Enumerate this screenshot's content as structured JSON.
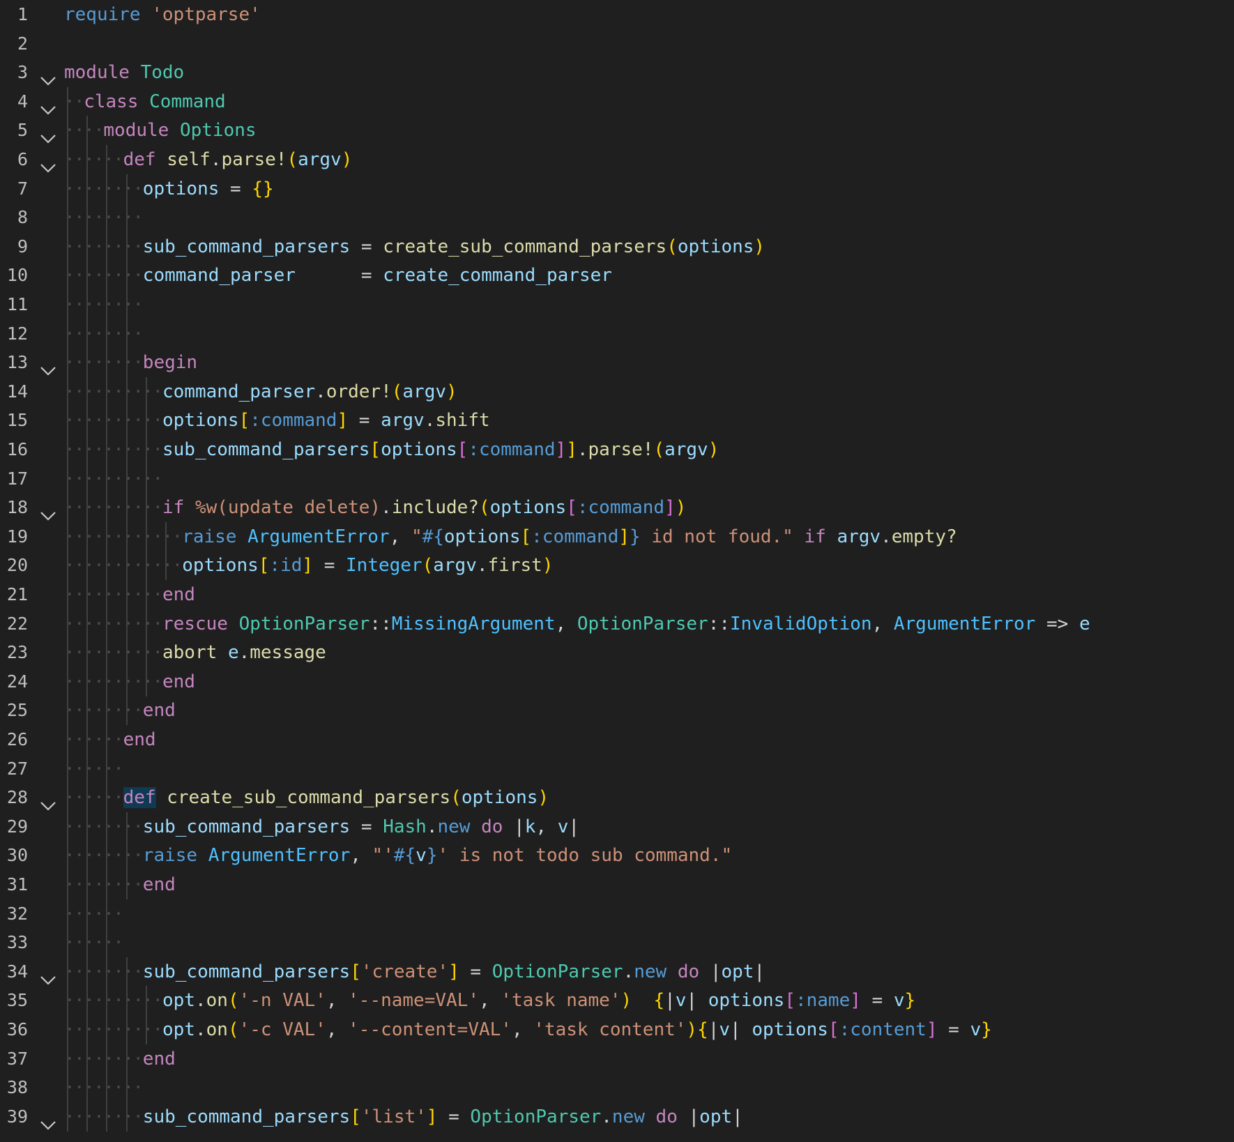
{
  "editor": {
    "language": "ruby",
    "colors": {
      "background": "#1f1f1f",
      "line_number": "#bfbfbf",
      "keyword": "#c586c0",
      "string": "#ce9178",
      "class": "#4ec9b0",
      "constant": "#4fc1ff",
      "function": "#dcdcaa",
      "variable": "#9cdcfe",
      "bracket_1": "#ffd700",
      "bracket_2": "#da70d6",
      "bracket_3": "#179fff",
      "selection": "#0f3a54"
    },
    "fold_icon": "chevron-down-icon",
    "lines": [
      {
        "n": "1",
        "fold": false,
        "indent": 0,
        "tokens": [
          [
            "t-kw2",
            "require"
          ],
          [
            "t-plain",
            " "
          ],
          [
            "t-str",
            "'optparse'"
          ]
        ]
      },
      {
        "n": "2",
        "fold": false,
        "indent": 0,
        "tokens": []
      },
      {
        "n": "3",
        "fold": true,
        "indent": 0,
        "tokens": [
          [
            "t-kw",
            "module"
          ],
          [
            "t-plain",
            " "
          ],
          [
            "t-cls",
            "Todo"
          ]
        ]
      },
      {
        "n": "4",
        "fold": true,
        "indent": 1,
        "tokens": [
          [
            "t-kw",
            "class"
          ],
          [
            "t-plain",
            " "
          ],
          [
            "t-cls",
            "Command"
          ]
        ]
      },
      {
        "n": "5",
        "fold": true,
        "indent": 2,
        "tokens": [
          [
            "t-kw",
            "module"
          ],
          [
            "t-plain",
            " "
          ],
          [
            "t-cls",
            "Options"
          ]
        ]
      },
      {
        "n": "6",
        "fold": true,
        "indent": 3,
        "tokens": [
          [
            "t-kw",
            "def"
          ],
          [
            "t-plain",
            " "
          ],
          [
            "t-fn",
            "self"
          ],
          [
            "t-plain",
            "."
          ],
          [
            "t-fn",
            "parse!"
          ],
          [
            "t-br1",
            "("
          ],
          [
            "t-var",
            "argv"
          ],
          [
            "t-br1",
            ")"
          ]
        ]
      },
      {
        "n": "7",
        "fold": false,
        "indent": 4,
        "tokens": [
          [
            "t-var",
            "options"
          ],
          [
            "t-plain",
            " = "
          ],
          [
            "t-br1",
            "{}"
          ]
        ]
      },
      {
        "n": "8",
        "fold": false,
        "indent": 4,
        "tokens": []
      },
      {
        "n": "9",
        "fold": false,
        "indent": 4,
        "tokens": [
          [
            "t-var",
            "sub_command_parsers"
          ],
          [
            "t-plain",
            " = "
          ],
          [
            "t-fn",
            "create_sub_command_parsers"
          ],
          [
            "t-br1",
            "("
          ],
          [
            "t-var",
            "options"
          ],
          [
            "t-br1",
            ")"
          ]
        ]
      },
      {
        "n": "10",
        "fold": false,
        "indent": 4,
        "tokens": [
          [
            "t-var",
            "command_parser"
          ],
          [
            "t-plain",
            "      = "
          ],
          [
            "t-var",
            "create_command_parser"
          ]
        ]
      },
      {
        "n": "11",
        "fold": false,
        "indent": 4,
        "tokens": []
      },
      {
        "n": "12",
        "fold": false,
        "indent": 4,
        "tokens": []
      },
      {
        "n": "13",
        "fold": true,
        "indent": 4,
        "tokens": [
          [
            "t-kw",
            "begin"
          ]
        ]
      },
      {
        "n": "14",
        "fold": false,
        "indent": 5,
        "tokens": [
          [
            "t-var",
            "command_parser"
          ],
          [
            "t-plain",
            "."
          ],
          [
            "t-fn",
            "order!"
          ],
          [
            "t-br1",
            "("
          ],
          [
            "t-var",
            "argv"
          ],
          [
            "t-br1",
            ")"
          ]
        ]
      },
      {
        "n": "15",
        "fold": false,
        "indent": 5,
        "tokens": [
          [
            "t-var",
            "options"
          ],
          [
            "t-br1",
            "["
          ],
          [
            "t-sym",
            ":command"
          ],
          [
            "t-br1",
            "]"
          ],
          [
            "t-plain",
            " = "
          ],
          [
            "t-var",
            "argv"
          ],
          [
            "t-plain",
            "."
          ],
          [
            "t-fn",
            "shift"
          ]
        ]
      },
      {
        "n": "16",
        "fold": false,
        "indent": 5,
        "tokens": [
          [
            "t-var",
            "sub_command_parsers"
          ],
          [
            "t-br1",
            "["
          ],
          [
            "t-var",
            "options"
          ],
          [
            "t-br2",
            "["
          ],
          [
            "t-sym",
            ":command"
          ],
          [
            "t-br2",
            "]"
          ],
          [
            "t-br1",
            "]"
          ],
          [
            "t-plain",
            "."
          ],
          [
            "t-fn",
            "parse!"
          ],
          [
            "t-br1",
            "("
          ],
          [
            "t-var",
            "argv"
          ],
          [
            "t-br1",
            ")"
          ]
        ]
      },
      {
        "n": "17",
        "fold": false,
        "indent": 5,
        "tokens": []
      },
      {
        "n": "18",
        "fold": true,
        "indent": 5,
        "tokens": [
          [
            "t-kw",
            "if"
          ],
          [
            "t-plain",
            " "
          ],
          [
            "t-str",
            "%w(update delete)"
          ],
          [
            "t-plain",
            "."
          ],
          [
            "t-fn",
            "include?"
          ],
          [
            "t-br1",
            "("
          ],
          [
            "t-var",
            "options"
          ],
          [
            "t-br2",
            "["
          ],
          [
            "t-sym",
            ":command"
          ],
          [
            "t-br2",
            "]"
          ],
          [
            "t-br1",
            ")"
          ]
        ]
      },
      {
        "n": "19",
        "fold": false,
        "indent": 6,
        "tokens": [
          [
            "t-kw2",
            "raise"
          ],
          [
            "t-plain",
            " "
          ],
          [
            "t-const",
            "ArgumentError"
          ],
          [
            "t-plain",
            ", "
          ],
          [
            "t-str",
            "\""
          ],
          [
            "t-sym",
            "#{"
          ],
          [
            "t-var",
            "options"
          ],
          [
            "t-br1",
            "["
          ],
          [
            "t-sym",
            ":command"
          ],
          [
            "t-br1",
            "]"
          ],
          [
            "t-sym",
            "}"
          ],
          [
            "t-str",
            " id not foud.\""
          ],
          [
            "t-plain",
            " "
          ],
          [
            "t-kw",
            "if"
          ],
          [
            "t-plain",
            " "
          ],
          [
            "t-var",
            "argv"
          ],
          [
            "t-plain",
            "."
          ],
          [
            "t-fn",
            "empty?"
          ]
        ]
      },
      {
        "n": "20",
        "fold": false,
        "indent": 6,
        "tokens": [
          [
            "t-var",
            "options"
          ],
          [
            "t-br1",
            "["
          ],
          [
            "t-sym",
            ":id"
          ],
          [
            "t-br1",
            "]"
          ],
          [
            "t-plain",
            " = "
          ],
          [
            "t-const",
            "Integer"
          ],
          [
            "t-br1",
            "("
          ],
          [
            "t-var",
            "argv"
          ],
          [
            "t-plain",
            "."
          ],
          [
            "t-fn",
            "first"
          ],
          [
            "t-br1",
            ")"
          ]
        ]
      },
      {
        "n": "21",
        "fold": false,
        "indent": 5,
        "tokens": [
          [
            "t-kw",
            "end"
          ]
        ]
      },
      {
        "n": "22",
        "fold": false,
        "indent": 5,
        "tokens": [
          [
            "t-kw",
            "rescue"
          ],
          [
            "t-plain",
            " "
          ],
          [
            "t-cls",
            "OptionParser"
          ],
          [
            "t-plain",
            "::"
          ],
          [
            "t-const",
            "MissingArgument"
          ],
          [
            "t-plain",
            ", "
          ],
          [
            "t-cls",
            "OptionParser"
          ],
          [
            "t-plain",
            "::"
          ],
          [
            "t-const",
            "InvalidOption"
          ],
          [
            "t-plain",
            ", "
          ],
          [
            "t-const",
            "ArgumentError"
          ],
          [
            "t-plain",
            " => "
          ],
          [
            "t-var",
            "e"
          ]
        ]
      },
      {
        "n": "23",
        "fold": false,
        "indent": 5,
        "tokens": [
          [
            "t-fn",
            "abort"
          ],
          [
            "t-plain",
            " "
          ],
          [
            "t-var",
            "e"
          ],
          [
            "t-plain",
            "."
          ],
          [
            "t-fn",
            "message"
          ]
        ]
      },
      {
        "n": "24",
        "fold": false,
        "indent": 5,
        "tokens": [
          [
            "t-kw",
            "end"
          ]
        ]
      },
      {
        "n": "25",
        "fold": false,
        "indent": 4,
        "tokens": [
          [
            "t-kw",
            "end"
          ]
        ]
      },
      {
        "n": "26",
        "fold": false,
        "indent": 3,
        "tokens": [
          [
            "t-kw",
            "end"
          ]
        ]
      },
      {
        "n": "27",
        "fold": false,
        "indent": 3,
        "tokens": []
      },
      {
        "n": "28",
        "fold": true,
        "indent": 3,
        "tokens": [
          [
            "t-kw sel",
            "def"
          ],
          [
            "t-plain",
            " "
          ],
          [
            "t-fn",
            "create_sub_command_parsers"
          ],
          [
            "t-br1",
            "("
          ],
          [
            "t-var",
            "options"
          ],
          [
            "t-br1",
            ")"
          ]
        ]
      },
      {
        "n": "29",
        "fold": false,
        "indent": 4,
        "tokens": [
          [
            "t-var",
            "sub_command_parsers"
          ],
          [
            "t-plain",
            " = "
          ],
          [
            "t-cls",
            "Hash"
          ],
          [
            "t-plain",
            "."
          ],
          [
            "t-kw2",
            "new"
          ],
          [
            "t-plain",
            " "
          ],
          [
            "t-kw",
            "do"
          ],
          [
            "t-plain",
            " |"
          ],
          [
            "t-var",
            "k"
          ],
          [
            "t-plain",
            ", "
          ],
          [
            "t-var",
            "v"
          ],
          [
            "t-plain",
            "|"
          ]
        ]
      },
      {
        "n": "30",
        "fold": false,
        "indent": 4,
        "tokens": [
          [
            "t-kw2",
            "raise"
          ],
          [
            "t-plain",
            " "
          ],
          [
            "t-const",
            "ArgumentError"
          ],
          [
            "t-plain",
            ", "
          ],
          [
            "t-str",
            "\"'"
          ],
          [
            "t-sym",
            "#{"
          ],
          [
            "t-var",
            "v"
          ],
          [
            "t-sym",
            "}"
          ],
          [
            "t-str",
            "' is not todo sub command.\""
          ]
        ]
      },
      {
        "n": "31",
        "fold": false,
        "indent": 4,
        "tokens": [
          [
            "t-kw",
            "end"
          ]
        ]
      },
      {
        "n": "32",
        "fold": false,
        "indent": 3,
        "tokens": []
      },
      {
        "n": "33",
        "fold": false,
        "indent": 3,
        "tokens": []
      },
      {
        "n": "34",
        "fold": true,
        "indent": 4,
        "tokens": [
          [
            "t-var",
            "sub_command_parsers"
          ],
          [
            "t-br1",
            "["
          ],
          [
            "t-str",
            "'create'"
          ],
          [
            "t-br1",
            "]"
          ],
          [
            "t-plain",
            " = "
          ],
          [
            "t-cls",
            "OptionParser"
          ],
          [
            "t-plain",
            "."
          ],
          [
            "t-kw2",
            "new"
          ],
          [
            "t-plain",
            " "
          ],
          [
            "t-kw",
            "do"
          ],
          [
            "t-plain",
            " |"
          ],
          [
            "t-var",
            "opt"
          ],
          [
            "t-plain",
            "|"
          ]
        ]
      },
      {
        "n": "35",
        "fold": false,
        "indent": 5,
        "tokens": [
          [
            "t-var",
            "opt"
          ],
          [
            "t-plain",
            "."
          ],
          [
            "t-fn",
            "on"
          ],
          [
            "t-br1",
            "("
          ],
          [
            "t-str",
            "'-n VAL'"
          ],
          [
            "t-plain",
            ", "
          ],
          [
            "t-str",
            "'--name=VAL'"
          ],
          [
            "t-plain",
            ", "
          ],
          [
            "t-str",
            "'task name'"
          ],
          [
            "t-br1",
            ")"
          ],
          [
            "t-plain",
            "  "
          ],
          [
            "t-br1",
            "{"
          ],
          [
            "t-plain",
            "|"
          ],
          [
            "t-var",
            "v"
          ],
          [
            "t-plain",
            "| "
          ],
          [
            "t-var",
            "options"
          ],
          [
            "t-br2",
            "["
          ],
          [
            "t-sym",
            ":name"
          ],
          [
            "t-br2",
            "]"
          ],
          [
            "t-plain",
            " = "
          ],
          [
            "t-var",
            "v"
          ],
          [
            "t-br1",
            "}"
          ]
        ]
      },
      {
        "n": "36",
        "fold": false,
        "indent": 5,
        "tokens": [
          [
            "t-var",
            "opt"
          ],
          [
            "t-plain",
            "."
          ],
          [
            "t-fn",
            "on"
          ],
          [
            "t-br1",
            "("
          ],
          [
            "t-str",
            "'-c VAL'"
          ],
          [
            "t-plain",
            ", "
          ],
          [
            "t-str",
            "'--content=VAL'"
          ],
          [
            "t-plain",
            ", "
          ],
          [
            "t-str",
            "'task content'"
          ],
          [
            "t-br1",
            ")"
          ],
          [
            "t-br1",
            "{"
          ],
          [
            "t-plain",
            "|"
          ],
          [
            "t-var",
            "v"
          ],
          [
            "t-plain",
            "| "
          ],
          [
            "t-var",
            "options"
          ],
          [
            "t-br2",
            "["
          ],
          [
            "t-sym",
            ":content"
          ],
          [
            "t-br2",
            "]"
          ],
          [
            "t-plain",
            " = "
          ],
          [
            "t-var",
            "v"
          ],
          [
            "t-br1",
            "}"
          ]
        ]
      },
      {
        "n": "37",
        "fold": false,
        "indent": 4,
        "tokens": [
          [
            "t-kw",
            "end"
          ]
        ]
      },
      {
        "n": "38",
        "fold": false,
        "indent": 4,
        "tokens": []
      },
      {
        "n": "39",
        "fold": true,
        "indent": 4,
        "tokens": [
          [
            "t-var",
            "sub_command_parsers"
          ],
          [
            "t-br1",
            "["
          ],
          [
            "t-str",
            "'list'"
          ],
          [
            "t-br1",
            "]"
          ],
          [
            "t-plain",
            " = "
          ],
          [
            "t-cls",
            "OptionParser"
          ],
          [
            "t-plain",
            "."
          ],
          [
            "t-kw2",
            "new"
          ],
          [
            "t-plain",
            " "
          ],
          [
            "t-kw",
            "do"
          ],
          [
            "t-plain",
            " |"
          ],
          [
            "t-var",
            "opt"
          ],
          [
            "t-plain",
            "|"
          ]
        ]
      }
    ]
  }
}
